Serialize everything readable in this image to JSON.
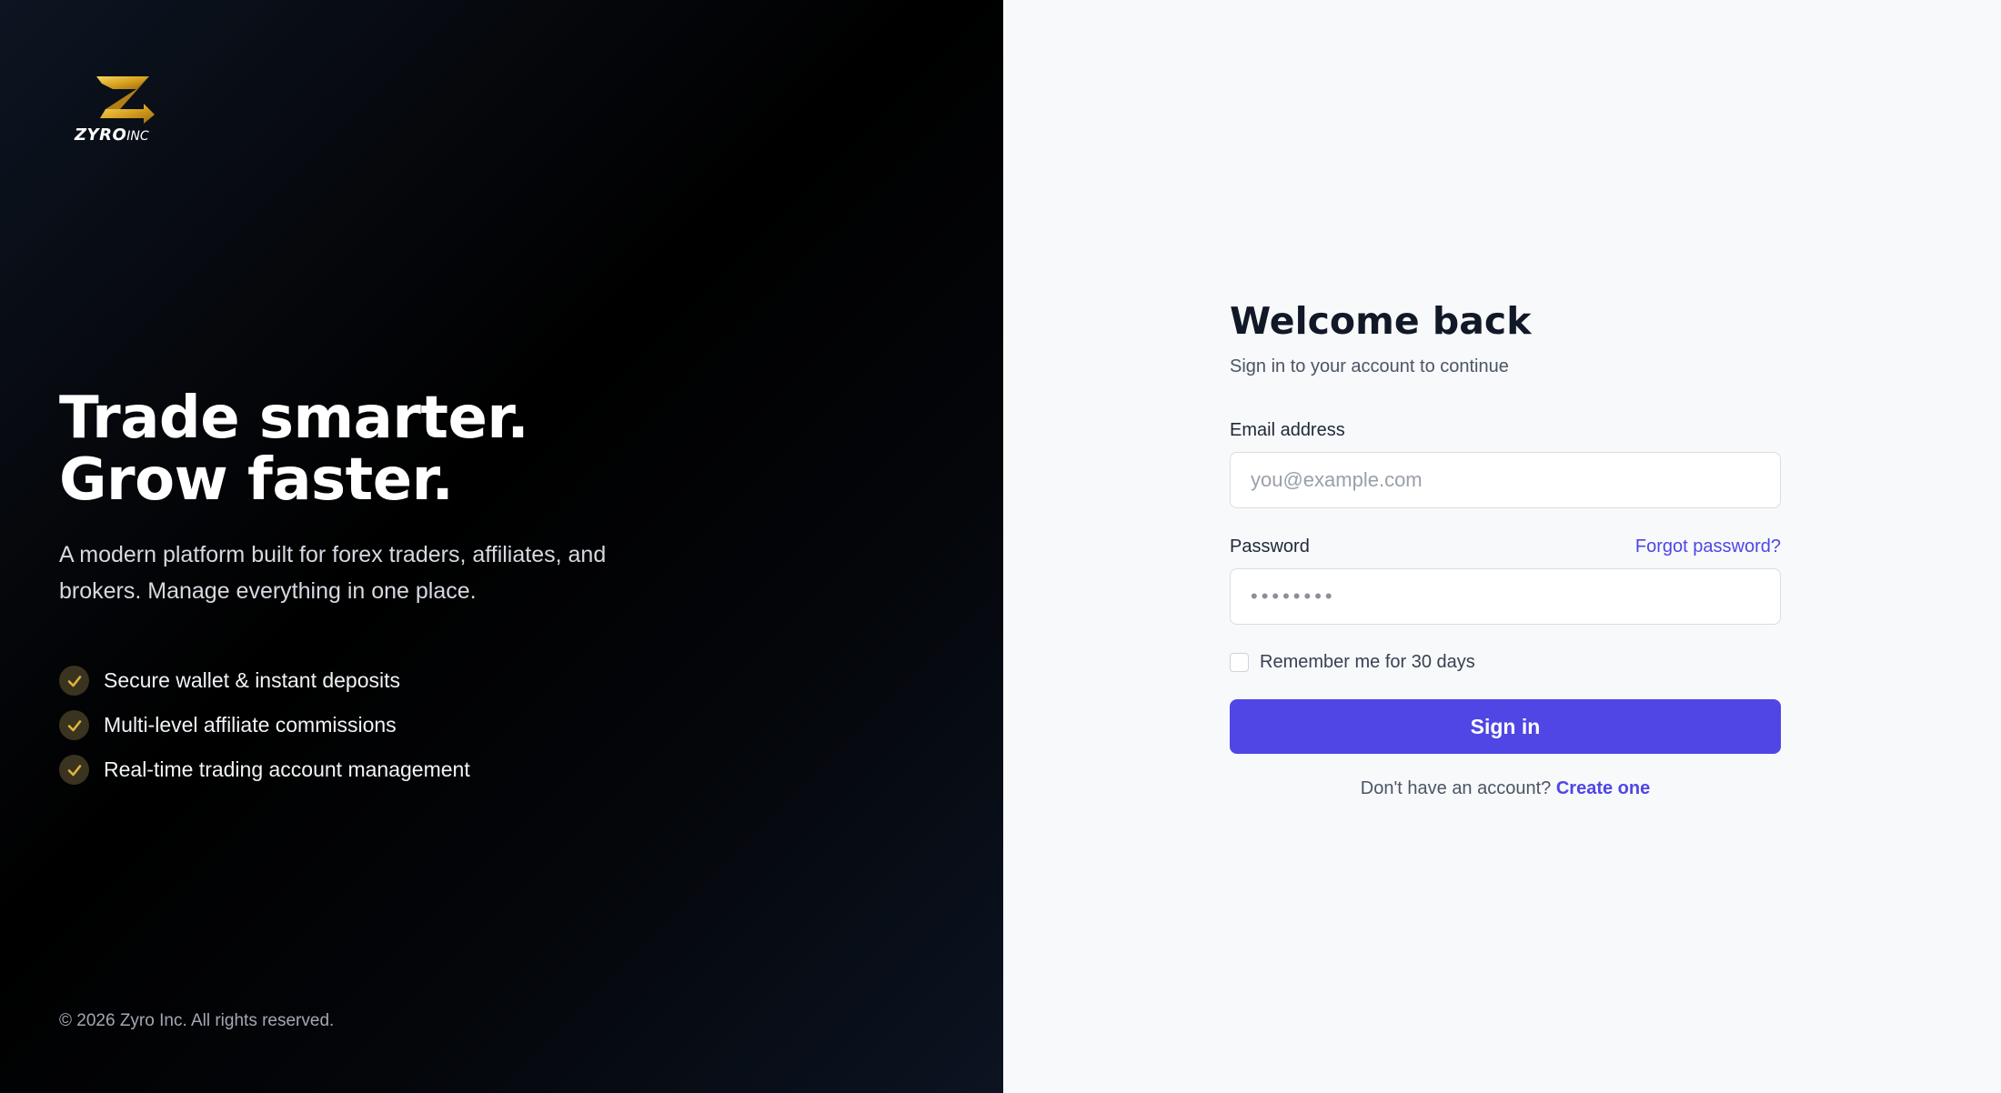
{
  "brand": {
    "logo_text": "ZYRO",
    "logo_suffix": "INC"
  },
  "hero": {
    "headline_line1": "Trade smarter.",
    "headline_line2": "Grow faster.",
    "tagline": "A modern platform built for forex traders, affiliates, and brokers. Manage everything in one place.",
    "features": [
      "Secure wallet & instant deposits",
      "Multi-level affiliate commissions",
      "Real-time trading account management"
    ],
    "copyright": "© 2026 Zyro Inc. All rights reserved."
  },
  "form": {
    "title": "Welcome back",
    "subtitle": "Sign in to your account to continue",
    "email_label": "Email address",
    "email_placeholder": "you@example.com",
    "email_value": "",
    "password_label": "Password",
    "password_placeholder": "••••••••",
    "password_value": "",
    "forgot_label": "Forgot password?",
    "remember_label": "Remember me for 30 days",
    "remember_checked": false,
    "signin_label": "Sign in",
    "signup_prompt": "Don't have an account?",
    "signup_link": "Create one"
  },
  "colors": {
    "accent": "#4f46e5",
    "gold": "#e0b43a",
    "left_bg": "#000000",
    "right_bg": "#f8f9fb"
  },
  "icons": {
    "logo": "zyro-z-logo-icon",
    "feature": "check-icon"
  }
}
